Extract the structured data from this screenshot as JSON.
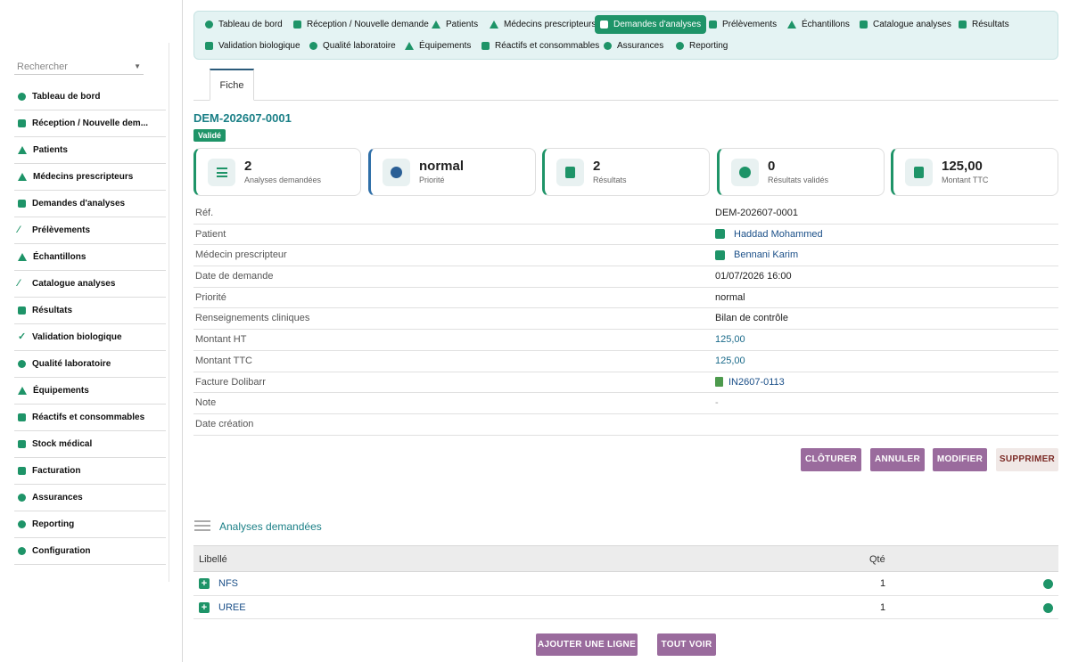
{
  "sidebar": {
    "search_placeholder": "Rechercher",
    "items": [
      {
        "label": "Tableau de bord",
        "icon": "dashboard-icon"
      },
      {
        "label": "Réception / Nouvelle dem...",
        "icon": "clipboard-icon"
      },
      {
        "label": "Patients",
        "icon": "user-icon"
      },
      {
        "label": "Médecins prescripteurs",
        "icon": "doctor-icon"
      },
      {
        "label": "Demandes d'analyses",
        "icon": "file-icon"
      },
      {
        "label": "Prélèvements",
        "icon": "syringe-icon"
      },
      {
        "label": "Échantillons",
        "icon": "flask-icon"
      },
      {
        "label": "Catalogue analyses",
        "icon": "pencil-icon"
      },
      {
        "label": "Résultats",
        "icon": "clipboard-check-icon"
      },
      {
        "label": "Validation biologique",
        "icon": "check-double-icon"
      },
      {
        "label": "Qualité laboratoire",
        "icon": "badge-icon"
      },
      {
        "label": "Équipements",
        "icon": "microscope-icon"
      },
      {
        "label": "Réactifs et consommables",
        "icon": "vial-icon"
      },
      {
        "label": "Stock médical",
        "icon": "boxes-icon"
      },
      {
        "label": "Facturation",
        "icon": "invoice-icon"
      },
      {
        "label": "Assurances",
        "icon": "shield-icon"
      },
      {
        "label": "Reporting",
        "icon": "chart-pie-icon"
      },
      {
        "label": "Configuration",
        "icon": "gear-icon"
      }
    ]
  },
  "topmenu": {
    "row1": [
      {
        "label": "Tableau de bord",
        "icon": "dashboard-icon"
      },
      {
        "label": "Réception / Nouvelle demande",
        "icon": "clipboard-icon"
      },
      {
        "label": "Patients",
        "icon": "user-icon"
      },
      {
        "label": "Médecins prescripteurs",
        "icon": "doctor-icon"
      },
      {
        "label": "Demandes d'analyses",
        "icon": "file-icon",
        "active": true
      },
      {
        "label": "Prélèvements",
        "icon": "syringe-icon"
      },
      {
        "label": "Échantillons",
        "icon": "flask-icon"
      },
      {
        "label": "Catalogue analyses",
        "icon": "pencil-icon"
      },
      {
        "label": "Résultats",
        "icon": "clipboard-check-icon"
      }
    ],
    "row2": [
      {
        "label": "Validation biologique",
        "icon": "check-double-icon"
      },
      {
        "label": "Qualité laboratoire",
        "icon": "badge-icon"
      },
      {
        "label": "Équipements",
        "icon": "microscope-icon"
      },
      {
        "label": "Réactifs et consommables",
        "icon": "vial-icon"
      },
      {
        "label": "Assurances",
        "icon": "shield-icon"
      },
      {
        "label": "Reporting",
        "icon": "chart-pie-icon"
      }
    ]
  },
  "tab": {
    "label": "Fiche"
  },
  "record": {
    "ref": "DEM-202607-0001",
    "status": "Validé"
  },
  "cards": [
    {
      "value": "2",
      "label": "Analyses demandées",
      "icon": "list-icon"
    },
    {
      "value": "normal",
      "label": "Priorité",
      "icon": "alert-circle-icon"
    },
    {
      "value": "2",
      "label": "Résultats",
      "icon": "clipboard-check-icon"
    },
    {
      "value": "0",
      "label": "Résultats validés",
      "icon": "check-circle-icon"
    },
    {
      "value": "125,00",
      "label": "Montant TTC",
      "icon": "invoice-dollar-icon"
    }
  ],
  "details": {
    "ref": {
      "label": "Réf.",
      "value": "DEM-202607-0001"
    },
    "patient": {
      "label": "Patient",
      "value": "Haddad Mohammed"
    },
    "doctor": {
      "label": "Médecin prescripteur",
      "value": "Bennani Karim"
    },
    "date": {
      "label": "Date de demande",
      "value": "01/07/2026 16:00"
    },
    "priority": {
      "label": "Priorité",
      "value": "normal"
    },
    "clinical": {
      "label": "Renseignements cliniques",
      "value": "Bilan de contrôle"
    },
    "ht": {
      "label": "Montant HT",
      "value": "125,00"
    },
    "ttc": {
      "label": "Montant TTC",
      "value": "125,00"
    },
    "invoice": {
      "label": "Facture Dolibarr",
      "value": "IN2607-0113"
    },
    "note": {
      "label": "Note",
      "value": "-"
    },
    "created": {
      "label": "Date création",
      "value": ""
    }
  },
  "actions": {
    "close": "CLÔTURER",
    "cancel": "ANNULER",
    "edit": "MODIFIER",
    "delete": "SUPPRIMER"
  },
  "analyses": {
    "title": "Analyses demandées",
    "col_label": "Libellé",
    "col_qty": "Qté",
    "rows": [
      {
        "label": "NFS",
        "qty": "1"
      },
      {
        "label": "UREE",
        "qty": "1"
      }
    ],
    "add_line": "AJOUTER UNE LIGNE",
    "see_all": "TOUT VOIR"
  }
}
